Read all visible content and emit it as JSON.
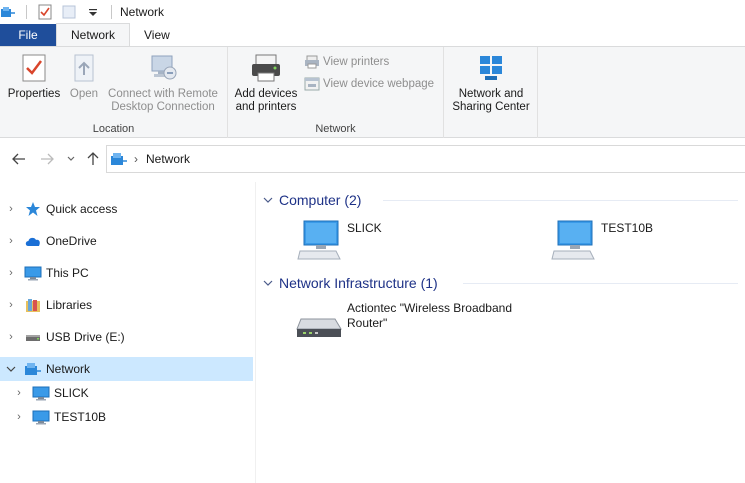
{
  "titlebar": {
    "title": "Network"
  },
  "tabs": {
    "file": "File",
    "network": "Network",
    "view": "View"
  },
  "ribbon": {
    "properties": "Properties",
    "open": "Open",
    "connect_remote": "Connect with Remote Desktop Connection",
    "location_label": "Location",
    "add_devices": "Add devices and printers",
    "view_printers": "View printers",
    "view_device_webpage": "View device webpage",
    "network_label": "Network",
    "network_sharing_center": "Network and Sharing Center"
  },
  "address": {
    "crumb": "Network"
  },
  "navpane": {
    "items": [
      {
        "label": "Quick access",
        "icon": "star-icon"
      },
      {
        "label": "OneDrive",
        "icon": "cloud-icon"
      },
      {
        "label": "This PC",
        "icon": "monitor-icon"
      },
      {
        "label": "Libraries",
        "icon": "library-icon"
      },
      {
        "label": "USB Drive (E:)",
        "icon": "usb-drive-icon"
      },
      {
        "label": "Network",
        "icon": "network-icon"
      },
      {
        "label": "SLICK",
        "icon": "computer-icon"
      },
      {
        "label": "TEST10B",
        "icon": "computer-icon"
      }
    ]
  },
  "content": {
    "computer_group": "Computer (2)",
    "computers": [
      {
        "name": "SLICK"
      },
      {
        "name": "TEST10B"
      }
    ],
    "infra_group": "Network Infrastructure (1)",
    "infra": [
      {
        "name": "Actiontec \"Wireless Broadband Router\""
      }
    ]
  },
  "colors": {
    "file_tab": "#1f4e9b",
    "selection": "#cce8ff",
    "group_header": "#1e3287"
  }
}
